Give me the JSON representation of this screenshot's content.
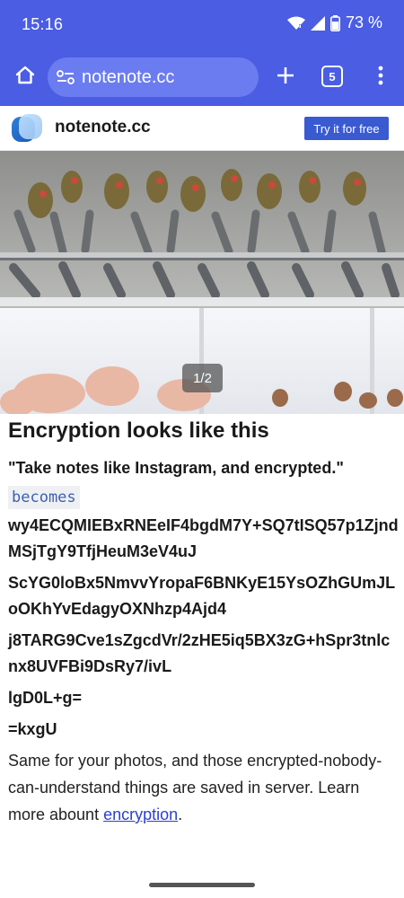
{
  "status_bar": {
    "time": "15:16",
    "battery_percent": "73 %",
    "icons": [
      "wifi-icon",
      "signal-icon",
      "battery-icon"
    ]
  },
  "browser": {
    "url": "notenote.cc",
    "tab_count": "5",
    "icons": [
      "home-icon",
      "site-settings-icon",
      "new-tab-icon",
      "menu-icon"
    ]
  },
  "site_header": {
    "name": "notenote.cc",
    "cta_label": "Try it for free"
  },
  "photo": {
    "counter": "1/2"
  },
  "article": {
    "title": "Encryption looks like this",
    "quote": "\"Take notes like Instagram, and encrypted.\"",
    "becomes_label": "becomes",
    "cipher_lines": [
      "wy4ECQMIEBxRNEeIF4bgdM7Y+SQ7tISQ57p1ZjndMSjTgY9TfjHeuM3eV4uJ",
      "ScYG0loBx5NmvvYropaF6BNKyE15YsOZhGUmJLoOKhYvEdagyOXNhzp4Ajd4",
      "j8TARG9Cve1sZgcdVr/2zHE5iq5BX3zG+hSpr3tnlcnx8UVFBi9DsRy7/ivL",
      "lgD0L+g=",
      "=kxgU"
    ],
    "description_before_link": "Same for your photos, and those encrypted-nobody-can-understand things are saved in server. Learn more abount ",
    "link_text": "encryption",
    "description_after_link": "."
  },
  "colors": {
    "browser_chrome": "#4a5de3",
    "url_pill": "#6b7cf0",
    "cta_button": "#3a5ad1",
    "link": "#2a3fd0",
    "code_text": "#3e5fb0"
  }
}
